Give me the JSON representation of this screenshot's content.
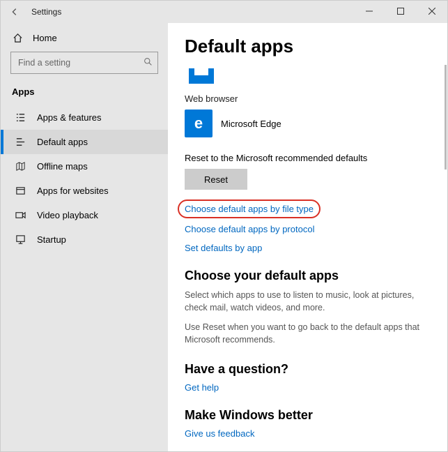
{
  "window": {
    "title": "Settings"
  },
  "sidebar": {
    "home": "Home",
    "search_placeholder": "Find a setting",
    "section": "Apps",
    "items": [
      {
        "label": "Apps & features"
      },
      {
        "label": "Default apps"
      },
      {
        "label": "Offline maps"
      },
      {
        "label": "Apps for websites"
      },
      {
        "label": "Video playback"
      },
      {
        "label": "Startup"
      }
    ]
  },
  "main": {
    "title": "Default apps",
    "web_browser_label": "Web browser",
    "web_browser_app": "Microsoft Edge",
    "reset_label": "Reset to the Microsoft recommended defaults",
    "reset_button": "Reset",
    "links": {
      "by_file_type": "Choose default apps by file type",
      "by_protocol": "Choose default apps by protocol",
      "by_app": "Set defaults by app"
    },
    "choose_heading": "Choose your default apps",
    "choose_desc1": "Select which apps to use to listen to music, look at pictures, check mail, watch videos, and more.",
    "choose_desc2": "Use Reset when you want to go back to the default apps that Microsoft recommends.",
    "question_heading": "Have a question?",
    "get_help": "Get help",
    "better_heading": "Make Windows better",
    "feedback": "Give us feedback"
  }
}
